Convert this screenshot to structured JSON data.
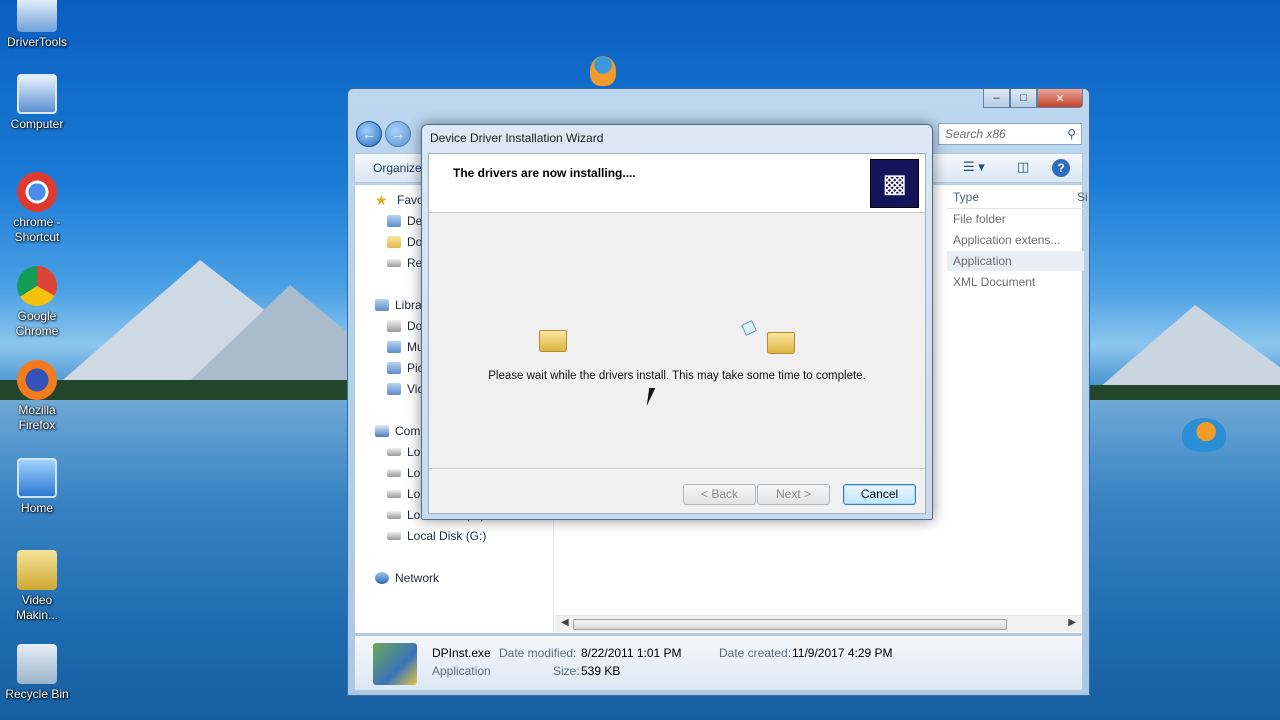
{
  "desktop": {
    "icons": [
      {
        "label": "DriverTools",
        "icon": "drivertools-icon"
      },
      {
        "label": "Computer",
        "icon": "computer-icon"
      },
      {
        "label": "chrome - Shortcut",
        "icon": "chrome-shortcut-icon"
      },
      {
        "label": "Google Chrome",
        "icon": "google-chrome-icon"
      },
      {
        "label": "Mozilla Firefox",
        "icon": "firefox-icon"
      },
      {
        "label": "Home",
        "icon": "home-icon"
      },
      {
        "label": "Video Makin...",
        "icon": "video-maker-icon"
      },
      {
        "label": "Recycle Bin",
        "icon": "recycle-bin-icon"
      }
    ]
  },
  "explorer": {
    "search_placeholder": "Search x86",
    "toolbar": {
      "organize": "Organize"
    },
    "nav": {
      "favorites": "Favo",
      "fav_items": [
        "De",
        "Do",
        "Rec"
      ],
      "libraries": "Libra",
      "lib_items": [
        "Do",
        "Mu",
        "Pic",
        "Vid"
      ],
      "computer": "Com",
      "drives": [
        "Loc",
        "Loc",
        "Loc",
        "Local Disk (F:)",
        "Local Disk (G:)"
      ],
      "network": "Network"
    },
    "columns": {
      "type": "Type",
      "size": "Si"
    },
    "files": [
      {
        "type": "File folder"
      },
      {
        "type": "Application extens..."
      },
      {
        "type": "Application"
      },
      {
        "type": "XML Document"
      }
    ],
    "details": {
      "name": "DPInst.exe",
      "kind": "Application",
      "modified_label": "Date modified:",
      "modified": "8/22/2011 1:01 PM",
      "created_label": "Date created:",
      "created": "11/9/2017 4:29 PM",
      "size_label": "Size:",
      "size": "539 KB"
    }
  },
  "wizard": {
    "title": "Device Driver Installation Wizard",
    "header": "The drivers are now installing....",
    "message": "Please wait while the drivers install. This may take some time to complete.",
    "buttons": {
      "back": "< Back",
      "next": "Next >",
      "cancel": "Cancel"
    }
  }
}
